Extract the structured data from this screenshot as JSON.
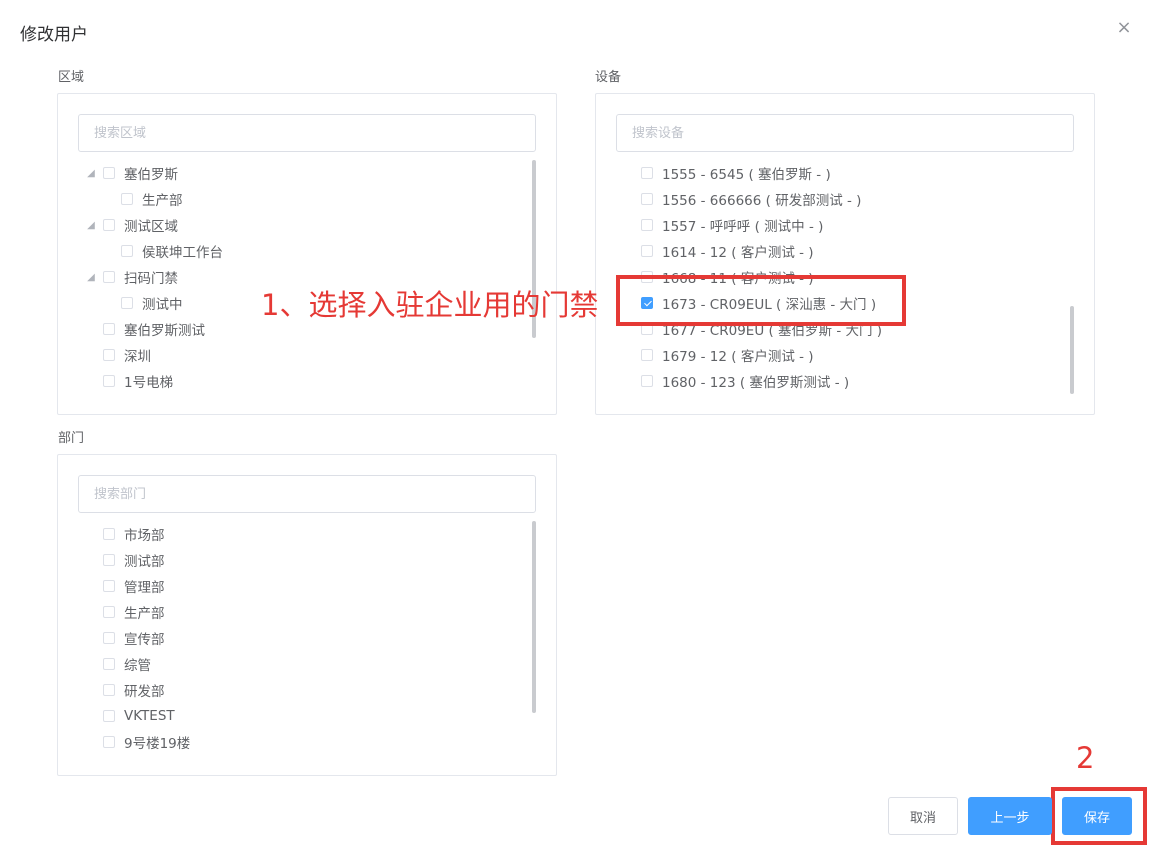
{
  "dialog": {
    "title": "修改用户",
    "close": "×"
  },
  "region": {
    "label": "区域",
    "search_placeholder": "搜索区域",
    "items": [
      {
        "label": "塞伯罗斯",
        "level": 0,
        "expandable": true,
        "checked": false
      },
      {
        "label": "生产部",
        "level": 1,
        "expandable": false,
        "checked": false
      },
      {
        "label": "测试区域",
        "level": 0,
        "expandable": true,
        "checked": false
      },
      {
        "label": "侯联坤工作台",
        "level": 1,
        "expandable": false,
        "checked": false
      },
      {
        "label": "扫码门禁",
        "level": 0,
        "expandable": true,
        "checked": false
      },
      {
        "label": "测试中",
        "level": 1,
        "expandable": false,
        "checked": false
      },
      {
        "label": "塞伯罗斯测试",
        "level": 0,
        "expandable": false,
        "checked": false
      },
      {
        "label": "深圳",
        "level": 0,
        "expandable": false,
        "checked": false
      },
      {
        "label": "1号电梯",
        "level": 0,
        "expandable": false,
        "checked": false
      }
    ]
  },
  "device": {
    "label": "设备",
    "search_placeholder": "搜索设备",
    "items": [
      {
        "label": "1555 - 6545 ( 塞伯罗斯 - )",
        "checked": false
      },
      {
        "label": "1556 - 666666 ( 研发部测试 - )",
        "checked": false
      },
      {
        "label": "1557 - 呼呼呼 ( 测试中 - )",
        "checked": false
      },
      {
        "label": "1614 - 12 ( 客户测试 - )",
        "checked": false
      },
      {
        "label": "1668 - 11 ( 客户测试 - )",
        "checked": false
      },
      {
        "label": "1673 - CR09EUL ( 深汕惠 - 大门 )",
        "checked": true
      },
      {
        "label": "1677 - CR09EU ( 塞伯罗斯 - 大门 )",
        "checked": false
      },
      {
        "label": "1679 - 12 ( 客户测试 - )",
        "checked": false
      },
      {
        "label": "1680 - 123 ( 塞伯罗斯测试 - )",
        "checked": false
      }
    ]
  },
  "department": {
    "label": "部门",
    "search_placeholder": "搜索部门",
    "items": [
      {
        "label": "市场部",
        "checked": false
      },
      {
        "label": "测试部",
        "checked": false
      },
      {
        "label": "管理部",
        "checked": false
      },
      {
        "label": "生产部",
        "checked": false
      },
      {
        "label": "宣传部",
        "checked": false
      },
      {
        "label": "综管",
        "checked": false
      },
      {
        "label": "研发部",
        "checked": false
      },
      {
        "label": "VKTEST",
        "checked": false
      },
      {
        "label": "9号楼19楼",
        "checked": false
      }
    ]
  },
  "annotations": {
    "step1": "1、选择入驻企业用的门禁",
    "step2": "2"
  },
  "footer": {
    "cancel": "取消",
    "prev": "上一步",
    "save": "保存"
  },
  "colors": {
    "primary": "#409eff",
    "annotation_red": "#e53935",
    "border": "#e4e7ed"
  }
}
